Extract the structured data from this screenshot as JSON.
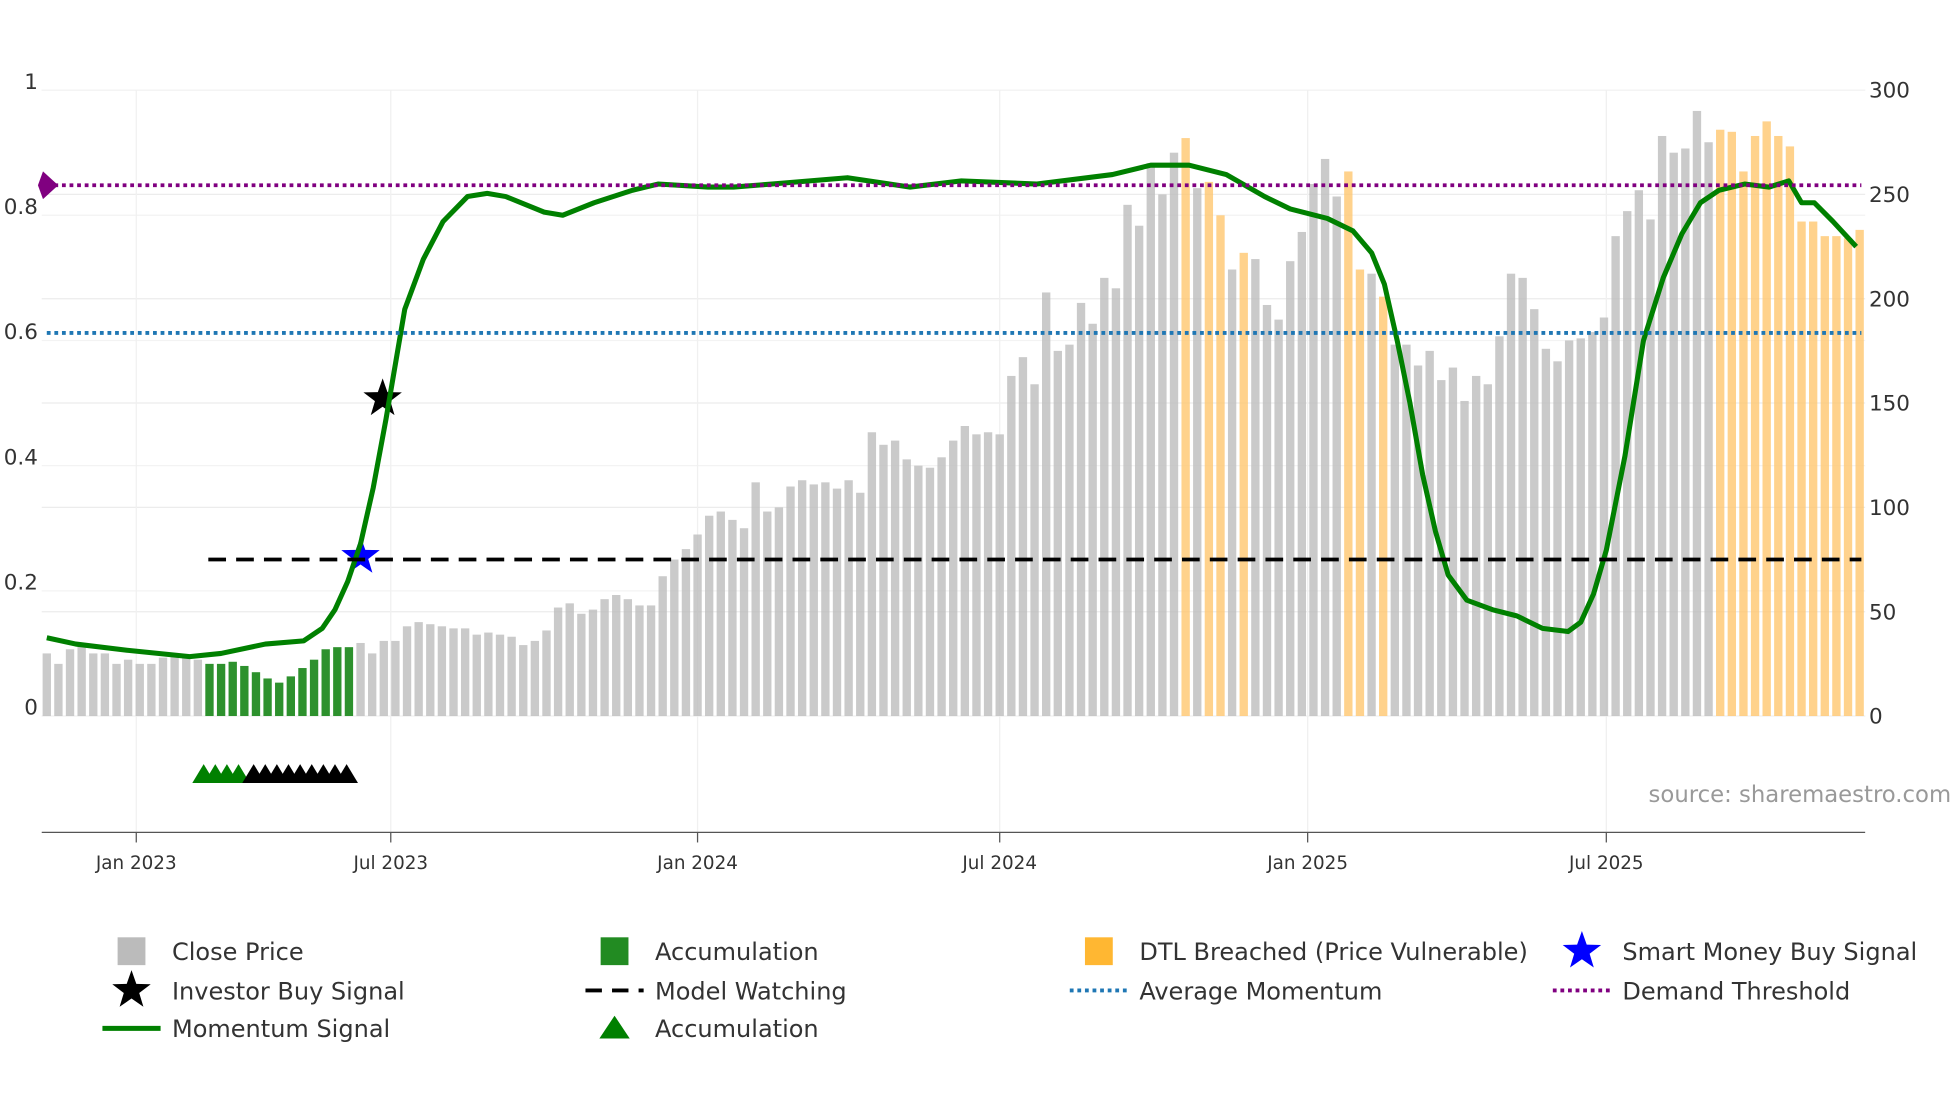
{
  "chart_data": {
    "type": "bar+line",
    "x_unit": "week index",
    "x_ticks": [
      {
        "week": 7.7,
        "label": "Jan 2023"
      },
      {
        "week": 29.6,
        "label": "Jul 2023"
      },
      {
        "week": 56.0,
        "label": "Jan 2024"
      },
      {
        "week": 82.0,
        "label": "Jul 2024"
      },
      {
        "week": 108.5,
        "label": "Jan 2025"
      },
      {
        "week": 134.2,
        "label": "Jul 2025"
      }
    ],
    "left_axis": {
      "range": [
        0,
        1
      ],
      "ticks": [
        "0",
        "0.2",
        "0.4",
        "0.6",
        "0.8",
        "1"
      ]
    },
    "right_axis": {
      "range": [
        0,
        300
      ],
      "ticks": [
        "0",
        "50",
        "100",
        "150",
        "200",
        "250",
        "300"
      ]
    },
    "close_price": {
      "values": [
        30,
        25,
        32,
        34,
        30,
        30,
        25,
        27,
        25,
        25,
        28,
        29,
        28,
        27,
        25,
        25,
        26,
        24,
        21,
        18,
        16,
        19,
        23,
        27,
        32,
        33,
        33,
        35,
        30,
        36,
        36,
        43,
        45,
        44,
        43,
        42,
        42,
        39,
        40,
        39,
        38,
        34,
        36,
        41,
        52,
        54,
        49,
        51,
        56,
        58,
        56,
        53,
        53,
        67,
        75,
        80,
        87,
        96,
        98,
        94,
        90,
        112,
        98,
        100,
        110,
        113,
        111,
        112,
        109,
        113,
        107,
        136,
        130,
        132,
        123,
        120,
        119,
        124,
        132,
        139,
        135,
        136,
        135,
        163,
        172,
        159,
        203,
        175,
        178,
        198,
        188,
        210,
        205,
        245,
        235,
        265,
        250,
        270,
        277,
        253,
        256,
        240,
        214,
        222,
        219,
        197,
        190,
        218,
        232,
        255,
        267,
        249,
        261,
        214,
        212,
        201,
        178,
        178,
        168,
        175,
        161,
        167,
        151,
        163,
        159,
        182,
        212,
        210,
        195,
        176,
        170,
        180,
        181,
        184,
        191,
        230,
        242,
        252,
        238,
        278,
        270,
        272,
        290,
        275,
        281,
        280,
        261,
        278,
        285,
        278,
        273,
        237,
        237,
        230,
        230,
        229,
        233
      ],
      "status": "ggggggggggggggaaaaaaaaaaaaagggggggggggggggggggggggggggggggggggggggggggggggggggggggggggggggggggggggdgddgdggggggggddgdggggggggggggggggggggggggggggdddddddddddddgggggg"
    },
    "momentum_signal": [
      [
        0,
        0.125
      ],
      [
        2.5,
        0.115
      ],
      [
        6.9,
        0.105
      ],
      [
        12.3,
        0.095
      ],
      [
        15,
        0.1
      ],
      [
        18.8,
        0.115
      ],
      [
        22.1,
        0.12
      ],
      [
        23.7,
        0.14
      ],
      [
        24.8,
        0.17
      ],
      [
        25.9,
        0.215
      ],
      [
        27,
        0.275
      ],
      [
        28.1,
        0.365
      ],
      [
        29.2,
        0.475
      ],
      [
        30.8,
        0.65
      ],
      [
        32.4,
        0.73
      ],
      [
        34.1,
        0.79
      ],
      [
        36.2,
        0.83
      ],
      [
        37.9,
        0.835
      ],
      [
        39.5,
        0.83
      ],
      [
        42.8,
        0.805
      ],
      [
        44.4,
        0.8
      ],
      [
        47.1,
        0.82
      ],
      [
        50.4,
        0.84
      ],
      [
        52.6,
        0.85
      ],
      [
        56.9,
        0.845
      ],
      [
        59.1,
        0.845
      ],
      [
        62.4,
        0.85
      ],
      [
        68.9,
        0.86
      ],
      [
        74.3,
        0.845
      ],
      [
        78.7,
        0.855
      ],
      [
        85.2,
        0.85
      ],
      [
        91.7,
        0.865
      ],
      [
        95,
        0.88
      ],
      [
        98.3,
        0.88
      ],
      [
        101.5,
        0.865
      ],
      [
        104.8,
        0.83
      ],
      [
        107,
        0.81
      ],
      [
        110.2,
        0.795
      ],
      [
        112.4,
        0.775
      ],
      [
        114,
        0.74
      ],
      [
        115.1,
        0.69
      ],
      [
        116.2,
        0.6
      ],
      [
        117.3,
        0.5
      ],
      [
        118.4,
        0.385
      ],
      [
        119.5,
        0.295
      ],
      [
        120.6,
        0.225
      ],
      [
        122.2,
        0.185
      ],
      [
        124.4,
        0.17
      ],
      [
        126.5,
        0.16
      ],
      [
        128.7,
        0.14
      ],
      [
        130.9,
        0.135
      ],
      [
        132,
        0.15
      ],
      [
        133.1,
        0.195
      ],
      [
        134.2,
        0.265
      ],
      [
        135.8,
        0.415
      ],
      [
        137.4,
        0.6
      ],
      [
        139.1,
        0.7
      ],
      [
        140.7,
        0.77
      ],
      [
        142.3,
        0.82
      ],
      [
        143.9,
        0.84
      ],
      [
        146.1,
        0.85
      ],
      [
        148.2,
        0.845
      ],
      [
        149.9,
        0.855
      ],
      [
        151,
        0.82
      ],
      [
        152.1,
        0.82
      ],
      [
        153.7,
        0.79
      ],
      [
        155.7,
        0.75
      ]
    ],
    "model_watching": {
      "value": 0.25,
      "from_week": 13.9
    },
    "average_momentum": 0.612,
    "demand_threshold": 0.848,
    "investor_buy_signal": {
      "week": 28.9,
      "value": 0.507
    },
    "smart_money_buy_signal": {
      "week": 27.0,
      "value": 0.255
    },
    "accumulation_triangles_green": [
      13.5,
      14.5,
      15.5,
      16.5
    ],
    "accumulation_triangles_black": [
      17.8,
      18.8,
      19.8,
      20.8,
      21.8,
      22.8,
      23.8,
      24.8,
      25.8
    ],
    "colors": {
      "gray": "#bbbbbb",
      "accumulation": "#228b22",
      "dtl": "#ffc56b",
      "momentum": "#008000",
      "avg": "#1f77b4",
      "demand": "#800080",
      "smart": "#0000ff"
    },
    "legend": [
      {
        "label": "Close Price",
        "kind": "square",
        "color": "#bbbbbb"
      },
      {
        "label": "Accumulation",
        "kind": "square",
        "color": "#228b22"
      },
      {
        "label": "DTL Breached (Price Vulnerable)",
        "kind": "square",
        "color": "#ffb732"
      },
      {
        "label": "Smart Money Buy Signal",
        "kind": "star",
        "color": "#0000ff"
      },
      {
        "label": "Investor Buy Signal",
        "kind": "star",
        "color": "#000000"
      },
      {
        "label": "Model Watching",
        "kind": "dash",
        "color": "#000000"
      },
      {
        "label": "Average Momentum",
        "kind": "dot",
        "color": "#1f77b4"
      },
      {
        "label": "Demand Threshold",
        "kind": "dot",
        "color": "#800080"
      },
      {
        "label": "Momentum Signal",
        "kind": "line",
        "color": "#008000"
      },
      {
        "label": "Accumulation",
        "kind": "triangle",
        "color": "#008000"
      }
    ],
    "source": "source: sharemaestro.com"
  }
}
